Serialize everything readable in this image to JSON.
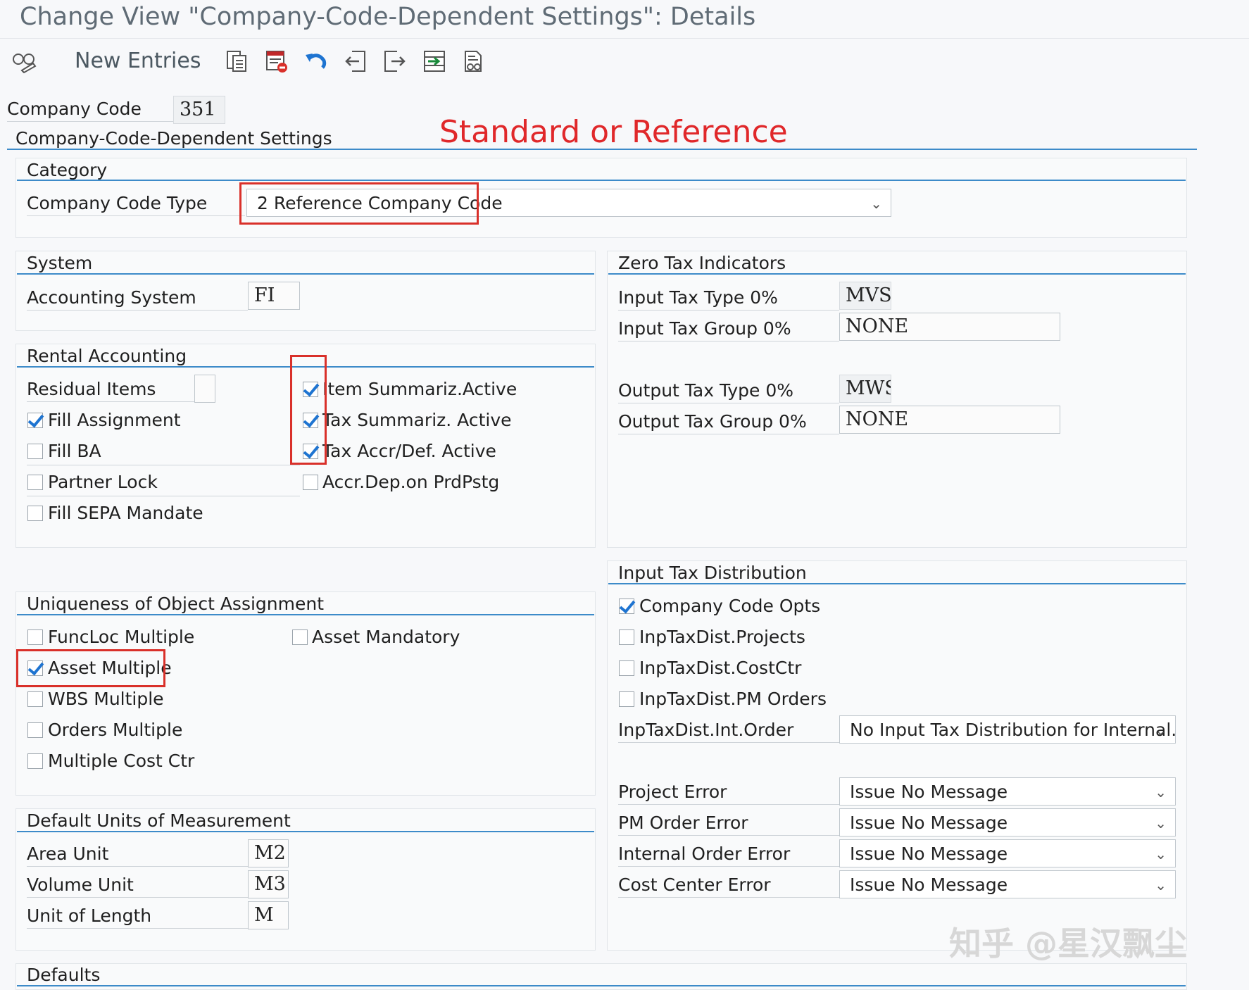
{
  "title": "Change View \"Company-Code-Dependent Settings\": Details",
  "toolbar": {
    "new_entries": "New Entries",
    "icons": [
      "display-change-icon",
      "copy-icon",
      "delete-icon",
      "undo-icon",
      "previous-entry-icon",
      "next-entry-icon",
      "select-all-icon",
      "other-view-icon"
    ]
  },
  "header": {
    "company_code_label": "Company Code",
    "company_code_value": "351"
  },
  "section_title": "Company-Code-Dependent Settings",
  "annotation": "Standard or Reference",
  "category": {
    "title": "Category",
    "company_code_type_label": "Company Code Type",
    "company_code_type_value": "2 Reference Company Code"
  },
  "system": {
    "title": "System",
    "accounting_system_label": "Accounting System",
    "accounting_system_value": "FI"
  },
  "rental": {
    "title": "Rental Accounting",
    "residual_items_label": "Residual Items",
    "residual_items_value": "",
    "fill_assignment": "Fill Assignment",
    "fill_ba": "Fill BA",
    "partner_lock": "Partner Lock",
    "fill_sepa": "Fill SEPA Mandate",
    "item_summariz": "Item Summariz.Active",
    "tax_summariz": "Tax Summariz. Active",
    "tax_accr": "Tax Accr/Def. Active",
    "accr_dep": "Accr.Dep.on PrdPstg"
  },
  "zero_tax": {
    "title": "Zero Tax Indicators",
    "input_type_label": "Input Tax Type 0%",
    "input_type_value": "MVST",
    "input_group_label": "Input Tax Group 0%",
    "input_group_value": "NONE",
    "output_type_label": "Output Tax Type 0%",
    "output_type_value": "MWST",
    "output_group_label": "Output Tax Group 0%",
    "output_group_value": "NONE"
  },
  "uniqueness": {
    "title": "Uniqueness of Object Assignment",
    "funcloc": "FuncLoc Multiple",
    "asset_multiple": "Asset Multiple",
    "wbs": "WBS Multiple",
    "orders": "Orders Multiple",
    "cost_ctr": "Multiple Cost Ctr",
    "asset_mandatory": "Asset Mandatory"
  },
  "input_tax_dist": {
    "title": "Input Tax Distribution",
    "cc_opts": "Company Code Opts",
    "projects": "InpTaxDist.Projects",
    "costctr": "InpTaxDist.CostCtr",
    "pm_orders": "InpTaxDist.PM Orders",
    "int_order_label": "InpTaxDist.Int.Order",
    "int_order_value": "No Input Tax Distribution for Internal...",
    "project_error_label": "Project Error",
    "project_error_value": "Issue No Message",
    "pm_order_error_label": "PM Order Error",
    "pm_order_error_value": "Issue No Message",
    "internal_order_error_label": "Internal Order Error",
    "internal_order_error_value": "Issue No Message",
    "cost_center_error_label": "Cost Center Error",
    "cost_center_error_value": "Issue No Message"
  },
  "units": {
    "title": "Default Units of Measurement",
    "area_label": "Area Unit",
    "area_value": "M2",
    "volume_label": "Volume Unit",
    "volume_value": "M3",
    "length_label": "Unit of Length",
    "length_value": "M"
  },
  "defaults": {
    "title": "Defaults"
  },
  "watermark": "知乎 @星汉飘尘",
  "colors": {
    "accent_line": "#3d8bc9",
    "annotation_red": "#e0282a",
    "check_blue": "#1e74d1"
  }
}
